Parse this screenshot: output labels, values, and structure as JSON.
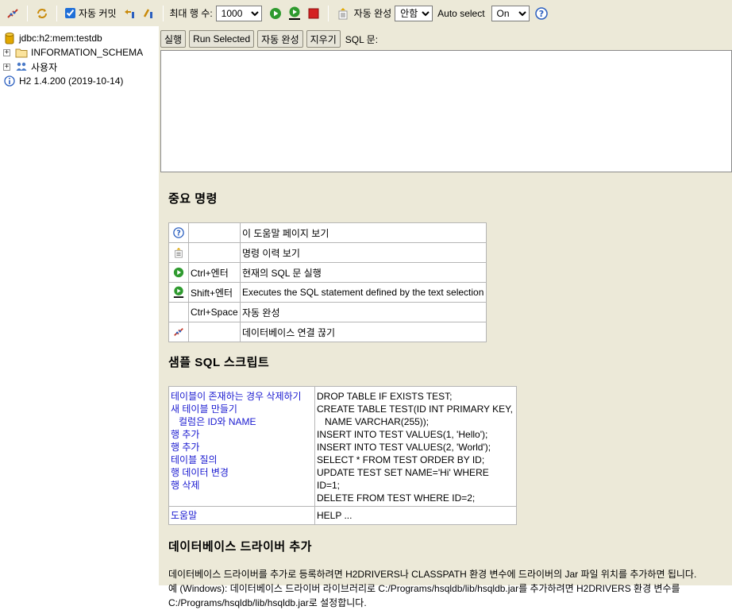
{
  "toolbar": {
    "auto_commit_label": "자동 커밋",
    "max_rows_label": "최대 행 수:",
    "max_rows_value": "1000",
    "auto_complete_label": "자동 완성",
    "auto_complete_value": "안함",
    "auto_select_label": "Auto select",
    "auto_select_value": "On"
  },
  "tree": {
    "connection": "jdbc:h2:mem:testdb",
    "schema": "INFORMATION_SCHEMA",
    "users": "사용자",
    "version": "H2 1.4.200 (2019-10-14)"
  },
  "commandbar": {
    "run": "실행",
    "run_selected": "Run Selected",
    "auto_complete": "자동 완성",
    "clear": "지우기",
    "sql_label": "SQL 문:"
  },
  "help": {
    "important_title": "중요 명령",
    "commands": [
      {
        "key": "",
        "desc": "이 도움말 페이지 보기"
      },
      {
        "key": "",
        "desc": "명령 이력 보기"
      },
      {
        "key": "Ctrl+엔터",
        "desc": "현재의 SQL 문 실행"
      },
      {
        "key": "Shift+엔터",
        "desc": "Executes the SQL statement defined by the text selection"
      },
      {
        "key": "Ctrl+Space",
        "desc": "자동 완성"
      },
      {
        "key": "",
        "desc": "데이터베이스 연결 끊기"
      }
    ],
    "samples_title": "샘플 SQL 스크립트",
    "samples": [
      {
        "label": "테이블이 존재하는 경우 삭제하기",
        "sql": "DROP TABLE IF EXISTS TEST;"
      },
      {
        "label": "새 테이블 만들기",
        "sql": "CREATE TABLE TEST(ID INT PRIMARY KEY,"
      },
      {
        "label": "  컬럼은 ID와 NAME",
        "sql": "   NAME VARCHAR(255));"
      },
      {
        "label": "행 추가",
        "sql": "INSERT INTO TEST VALUES(1, 'Hello');"
      },
      {
        "label": "행 추가",
        "sql": "INSERT INTO TEST VALUES(2, 'World');"
      },
      {
        "label": "테이블 질의",
        "sql": "SELECT * FROM TEST ORDER BY ID;"
      },
      {
        "label": "행 데이터 변경",
        "sql": "UPDATE TEST SET NAME='Hi' WHERE ID=1;"
      },
      {
        "label": "행 삭제",
        "sql": "DELETE FROM TEST WHERE ID=2;"
      }
    ],
    "help_label": "도움말",
    "help_sql": "HELP ...",
    "driver_title": "데이터베이스 드라이버 추가",
    "driver_para1": "데이터베이스 드라이버를 추가로 등록하려면 H2DRIVERS나 CLASSPATH 환경 변수에 드라이버의 Jar 파일 위치를 추가하면 됩니다.",
    "driver_para2": "예 (Windows): 데이터베이스 드라이버 라이브러리로 C:/Programs/hsqldb/lib/hsqldb.jar를 추가하려면 H2DRIVERS 환경 변수를",
    "driver_para3": "C:/Programs/hsqldb/lib/hsqldb.jar로 설정합니다."
  }
}
